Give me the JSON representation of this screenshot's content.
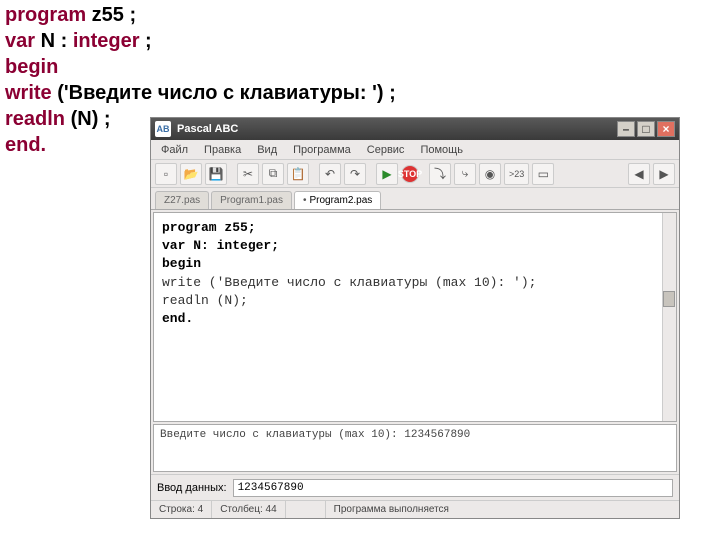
{
  "code_display": {
    "l1_kw": "program",
    "l1_rest": " z55 ;",
    "l2_kw": "var",
    "l2_mid": " N : ",
    "l2_kw2": "integer",
    "l2_rest": " ;",
    "l3_kw": "begin",
    "l4_kw": "write",
    "l4_rest": " ('Введите число с клавиатуры: ') ;",
    "l5_kw": "readln",
    "l5_rest": " (N) ;",
    "l6_kw": "end."
  },
  "ide": {
    "title": "Pascal ABC",
    "menu": [
      "Файл",
      "Правка",
      "Вид",
      "Программа",
      "Сервис",
      "Помощь"
    ],
    "tabs": [
      "Z27.pas",
      "Program1.pas",
      "Program2.pas"
    ],
    "editor_lines": [
      "program z55;",
      "var N: integer;",
      "begin",
      "write ('Введите число с клавиатуры (max 10): ');",
      "readln (N);",
      "end."
    ],
    "console_line": "Введите число с клавиатуры (max 10): 1234567890",
    "input_label": "Ввод данных:",
    "input_value": "1234567890",
    "status": {
      "line": "Строка: 4",
      "col": "Столбец: 44",
      "state": "Программа выполняется"
    },
    "toolbar_text": {
      "x23": ">23"
    }
  }
}
